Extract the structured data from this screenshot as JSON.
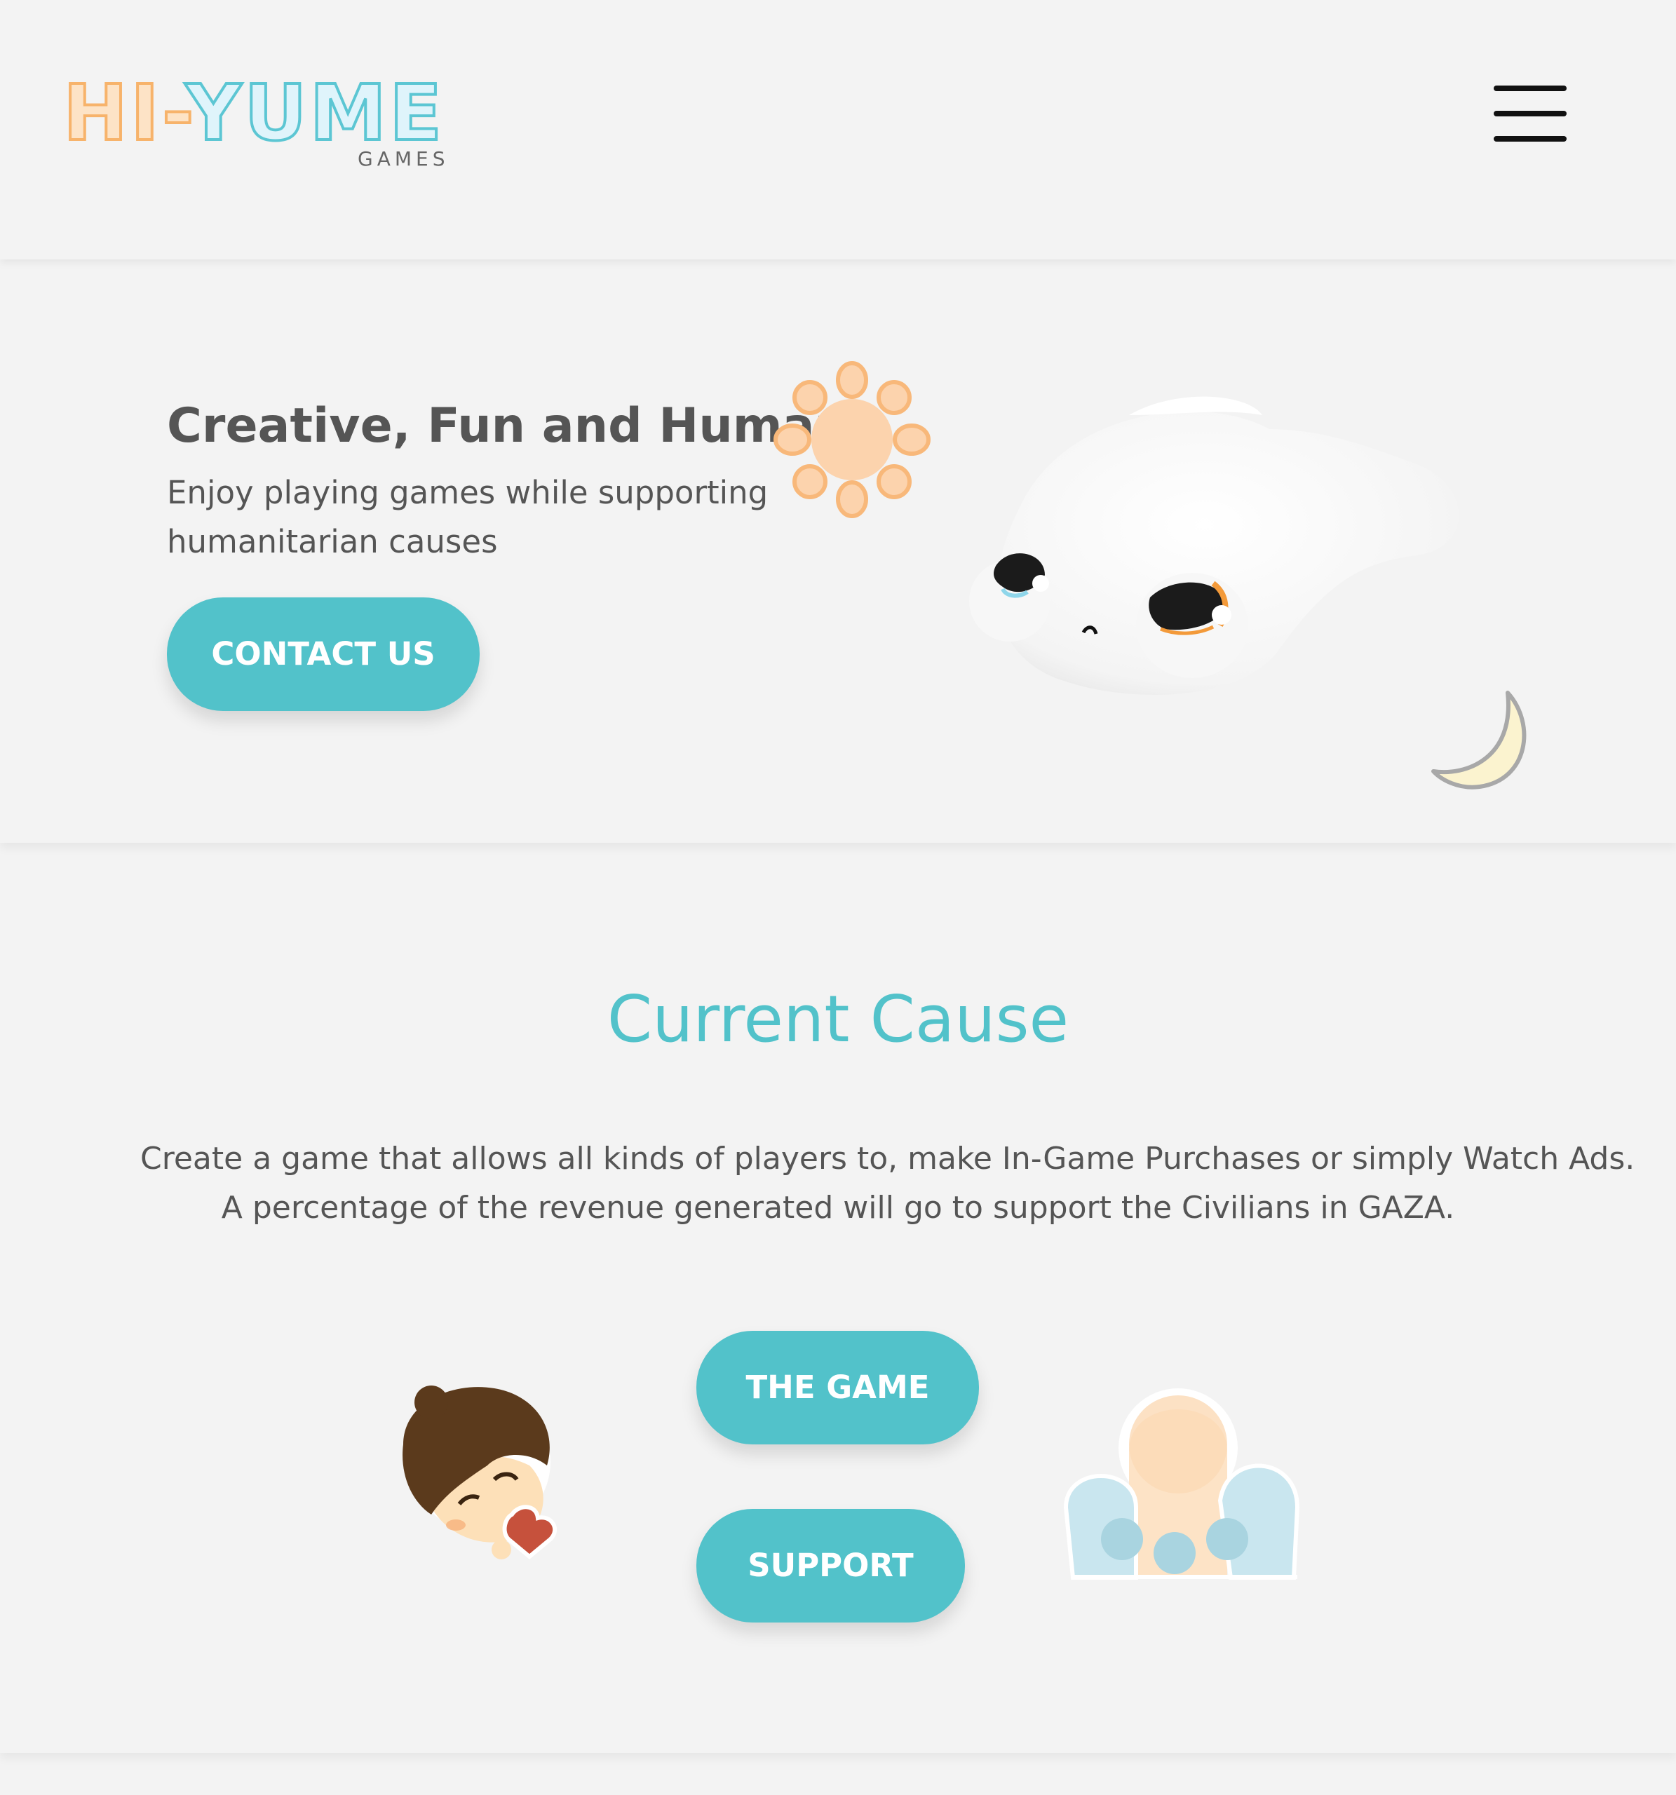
{
  "header": {
    "logo": {
      "word_hi": "HI",
      "word_dash": "-",
      "word_yume": "YUME",
      "sub": "GAMES"
    },
    "menu_icon": "hamburger-menu-icon"
  },
  "hero": {
    "title": "Creative, Fun and Humane",
    "subtitle": "Enjoy playing games while supporting humanitarian causes",
    "contact_label": "CONTACT US"
  },
  "cause": {
    "title": "Current Cause",
    "text_line1": "Create a game that allows all kinds of players to, make In-Game Purchases or simply Watch Ads.",
    "text_line2": "A percentage of the revenue generated will go to support the Civilians in GAZA.",
    "game_label": "THE GAME",
    "support_label": "SUPPORT"
  },
  "colors": {
    "accent": "#52c2ca",
    "background": "#f3f3f3",
    "text": "#555555",
    "logo_orange": "#f7b36b",
    "logo_blue": "#5cc6d3"
  }
}
